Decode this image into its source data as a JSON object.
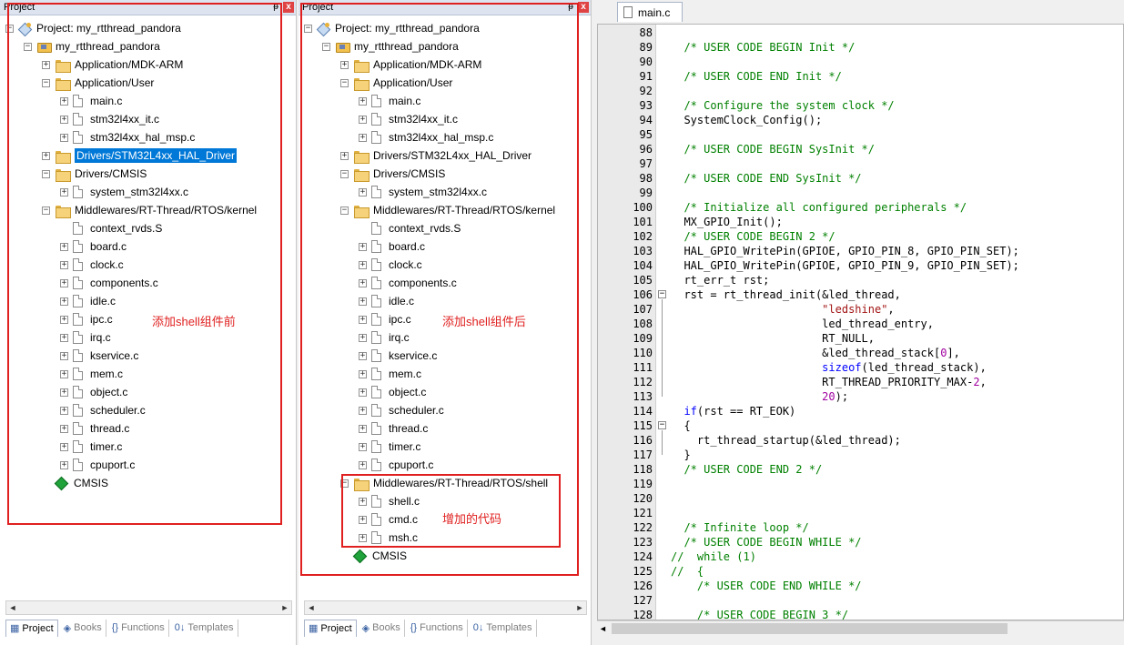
{
  "panel1": {
    "title": "Project",
    "pin": "ᵽ",
    "close": "x",
    "annotation": "添加shell组件前",
    "tree": [
      {
        "label": "Project: my_rtthread_pandora",
        "kind": "project",
        "expander": "−",
        "indent": 0
      },
      {
        "label": "my_rtthread_pandora",
        "kind": "target",
        "expander": "−",
        "indent": 1
      },
      {
        "label": "Application/MDK-ARM",
        "kind": "folder",
        "expander": "+",
        "indent": 2
      },
      {
        "label": "Application/User",
        "kind": "folder",
        "expander": "−",
        "indent": 2
      },
      {
        "label": "main.c",
        "kind": "file",
        "expander": "+",
        "indent": 3
      },
      {
        "label": "stm32l4xx_it.c",
        "kind": "file",
        "expander": "+",
        "indent": 3
      },
      {
        "label": "stm32l4xx_hal_msp.c",
        "kind": "file",
        "expander": "+",
        "indent": 3
      },
      {
        "label": "Drivers/STM32L4xx_HAL_Driver",
        "kind": "folder",
        "expander": "+",
        "indent": 2,
        "selected": true
      },
      {
        "label": "Drivers/CMSIS",
        "kind": "folder",
        "expander": "−",
        "indent": 2
      },
      {
        "label": "system_stm32l4xx.c",
        "kind": "file",
        "expander": "+",
        "indent": 3
      },
      {
        "label": "Middlewares/RT-Thread/RTOS/kernel",
        "kind": "folder",
        "expander": "−",
        "indent": 2
      },
      {
        "label": "context_rvds.S",
        "kind": "file",
        "expander": "",
        "indent": 3
      },
      {
        "label": "board.c",
        "kind": "file",
        "expander": "+",
        "indent": 3
      },
      {
        "label": "clock.c",
        "kind": "file",
        "expander": "+",
        "indent": 3
      },
      {
        "label": "components.c",
        "kind": "file",
        "expander": "+",
        "indent": 3
      },
      {
        "label": "idle.c",
        "kind": "file",
        "expander": "+",
        "indent": 3
      },
      {
        "label": "ipc.c",
        "kind": "file",
        "expander": "+",
        "indent": 3
      },
      {
        "label": "irq.c",
        "kind": "file",
        "expander": "+",
        "indent": 3
      },
      {
        "label": "kservice.c",
        "kind": "file",
        "expander": "+",
        "indent": 3
      },
      {
        "label": "mem.c",
        "kind": "file",
        "expander": "+",
        "indent": 3
      },
      {
        "label": "object.c",
        "kind": "file",
        "expander": "+",
        "indent": 3
      },
      {
        "label": "scheduler.c",
        "kind": "file",
        "expander": "+",
        "indent": 3
      },
      {
        "label": "thread.c",
        "kind": "file",
        "expander": "+",
        "indent": 3
      },
      {
        "label": "timer.c",
        "kind": "file",
        "expander": "+",
        "indent": 3
      },
      {
        "label": "cpuport.c",
        "kind": "file",
        "expander": "+",
        "indent": 3
      },
      {
        "label": "CMSIS",
        "kind": "cmsis",
        "expander": "",
        "indent": 2
      }
    ]
  },
  "panel2": {
    "title": "Project",
    "pin": "ᵽ",
    "close": "x",
    "annotation": "添加shell组件后",
    "annotation2": "增加的代码",
    "tree": [
      {
        "label": "Project: my_rtthread_pandora",
        "kind": "project",
        "expander": "−",
        "indent": 0
      },
      {
        "label": "my_rtthread_pandora",
        "kind": "target",
        "expander": "−",
        "indent": 1
      },
      {
        "label": "Application/MDK-ARM",
        "kind": "folder",
        "expander": "+",
        "indent": 2
      },
      {
        "label": "Application/User",
        "kind": "folder",
        "expander": "−",
        "indent": 2
      },
      {
        "label": "main.c",
        "kind": "file",
        "expander": "+",
        "indent": 3
      },
      {
        "label": "stm32l4xx_it.c",
        "kind": "file",
        "expander": "+",
        "indent": 3
      },
      {
        "label": "stm32l4xx_hal_msp.c",
        "kind": "file",
        "expander": "+",
        "indent": 3
      },
      {
        "label": "Drivers/STM32L4xx_HAL_Driver",
        "kind": "folder",
        "expander": "+",
        "indent": 2
      },
      {
        "label": "Drivers/CMSIS",
        "kind": "folder",
        "expander": "−",
        "indent": 2
      },
      {
        "label": "system_stm32l4xx.c",
        "kind": "file",
        "expander": "+",
        "indent": 3
      },
      {
        "label": "Middlewares/RT-Thread/RTOS/kernel",
        "kind": "folder",
        "expander": "−",
        "indent": 2
      },
      {
        "label": "context_rvds.S",
        "kind": "file",
        "expander": "",
        "indent": 3
      },
      {
        "label": "board.c",
        "kind": "file",
        "expander": "+",
        "indent": 3
      },
      {
        "label": "clock.c",
        "kind": "file",
        "expander": "+",
        "indent": 3
      },
      {
        "label": "components.c",
        "kind": "file",
        "expander": "+",
        "indent": 3
      },
      {
        "label": "idle.c",
        "kind": "file",
        "expander": "+",
        "indent": 3
      },
      {
        "label": "ipc.c",
        "kind": "file",
        "expander": "+",
        "indent": 3
      },
      {
        "label": "irq.c",
        "kind": "file",
        "expander": "+",
        "indent": 3
      },
      {
        "label": "kservice.c",
        "kind": "file",
        "expander": "+",
        "indent": 3
      },
      {
        "label": "mem.c",
        "kind": "file",
        "expander": "+",
        "indent": 3
      },
      {
        "label": "object.c",
        "kind": "file",
        "expander": "+",
        "indent": 3
      },
      {
        "label": "scheduler.c",
        "kind": "file",
        "expander": "+",
        "indent": 3
      },
      {
        "label": "thread.c",
        "kind": "file",
        "expander": "+",
        "indent": 3
      },
      {
        "label": "timer.c",
        "kind": "file",
        "expander": "+",
        "indent": 3
      },
      {
        "label": "cpuport.c",
        "kind": "file",
        "expander": "+",
        "indent": 3
      },
      {
        "label": "Middlewares/RT-Thread/RTOS/shell",
        "kind": "folder",
        "expander": "−",
        "indent": 2
      },
      {
        "label": "shell.c",
        "kind": "file",
        "expander": "+",
        "indent": 3
      },
      {
        "label": "cmd.c",
        "kind": "file",
        "expander": "+",
        "indent": 3
      },
      {
        "label": "msh.c",
        "kind": "file",
        "expander": "+",
        "indent": 3
      },
      {
        "label": "CMSIS",
        "kind": "cmsis",
        "expander": "",
        "indent": 2
      }
    ]
  },
  "bottom_tabs": [
    {
      "label": "Project",
      "icon": "▦",
      "active": true
    },
    {
      "label": "Books",
      "icon": "◈",
      "active": false
    },
    {
      "label": "Functions",
      "icon": "{}",
      "active": false
    },
    {
      "label": "Templates",
      "icon": "0↓",
      "active": false
    }
  ],
  "scroll": {
    "left": "◄",
    "right": "►"
  },
  "editor": {
    "tab": "main.c",
    "lines": [
      {
        "n": "88",
        "fold": "",
        "segs": []
      },
      {
        "n": "89",
        "fold": "",
        "segs": [
          [
            "cm",
            "  /* USER CODE BEGIN Init */"
          ]
        ]
      },
      {
        "n": "90",
        "fold": "",
        "segs": []
      },
      {
        "n": "91",
        "fold": "",
        "segs": [
          [
            "cm",
            "  /* USER CODE END Init */"
          ]
        ]
      },
      {
        "n": "92",
        "fold": "",
        "segs": []
      },
      {
        "n": "93",
        "fold": "",
        "segs": [
          [
            "cm",
            "  /* Configure the system clock */"
          ]
        ]
      },
      {
        "n": "94",
        "fold": "",
        "segs": [
          [
            "",
            "  SystemClock_Config();"
          ]
        ]
      },
      {
        "n": "95",
        "fold": "",
        "segs": []
      },
      {
        "n": "96",
        "fold": "",
        "segs": [
          [
            "cm",
            "  /* USER CODE BEGIN SysInit */"
          ]
        ]
      },
      {
        "n": "97",
        "fold": "",
        "segs": []
      },
      {
        "n": "98",
        "fold": "",
        "segs": [
          [
            "cm",
            "  /* USER CODE END SysInit */"
          ]
        ]
      },
      {
        "n": "99",
        "fold": "",
        "segs": []
      },
      {
        "n": "100",
        "fold": "",
        "segs": [
          [
            "cm",
            "  /* Initialize all configured peripherals */"
          ]
        ]
      },
      {
        "n": "101",
        "fold": "",
        "segs": [
          [
            "",
            "  MX_GPIO_Init();"
          ]
        ]
      },
      {
        "n": "102",
        "fold": "",
        "segs": [
          [
            "cm",
            "  /* USER CODE BEGIN 2 */"
          ]
        ]
      },
      {
        "n": "103",
        "fold": "",
        "segs": [
          [
            "",
            "  HAL_GPIO_WritePin(GPIOE, GPIO_PIN_8, GPIO_PIN_SET);"
          ]
        ]
      },
      {
        "n": "104",
        "fold": "",
        "segs": [
          [
            "",
            "  HAL_GPIO_WritePin(GPIOE, GPIO_PIN_9, GPIO_PIN_SET);"
          ]
        ]
      },
      {
        "n": "105",
        "fold": "",
        "segs": [
          [
            "",
            "  rt_err_t rst;"
          ]
        ]
      },
      {
        "n": "106",
        "fold": "−",
        "segs": [
          [
            "",
            "  rst = rt_thread_init(&led_thread,"
          ]
        ]
      },
      {
        "n": "107",
        "fold": "",
        "segs": [
          [
            "",
            "                       "
          ],
          [
            "st",
            "\"ledshine\""
          ],
          [
            "",
            ","
          ]
        ]
      },
      {
        "n": "108",
        "fold": "",
        "segs": [
          [
            "",
            "                       led_thread_entry,"
          ]
        ]
      },
      {
        "n": "109",
        "fold": "",
        "segs": [
          [
            "",
            "                       RT_NULL,"
          ]
        ]
      },
      {
        "n": "110",
        "fold": "",
        "segs": [
          [
            "",
            "                       &led_thread_stack["
          ],
          [
            "nm",
            "0"
          ],
          [
            "",
            "],"
          ]
        ]
      },
      {
        "n": "111",
        "fold": "",
        "segs": [
          [
            "",
            "                       "
          ],
          [
            "kw",
            "sizeof"
          ],
          [
            "",
            "(led_thread_stack),"
          ]
        ]
      },
      {
        "n": "112",
        "fold": "",
        "segs": [
          [
            "",
            "                       RT_THREAD_PRIORITY_MAX-"
          ],
          [
            "nm",
            "2"
          ],
          [
            "",
            ","
          ]
        ]
      },
      {
        "n": "113",
        "fold": "",
        "segs": [
          [
            "",
            "                       "
          ],
          [
            "nm",
            "20"
          ],
          [
            "",
            ");"
          ]
        ]
      },
      {
        "n": "114",
        "fold": "",
        "segs": [
          [
            "",
            "  "
          ],
          [
            "kw",
            "if"
          ],
          [
            "",
            "(rst == RT_EOK)"
          ]
        ]
      },
      {
        "n": "115",
        "fold": "−",
        "segs": [
          [
            "",
            "  {"
          ]
        ]
      },
      {
        "n": "116",
        "fold": "",
        "segs": [
          [
            "",
            "    rt_thread_startup(&led_thread);"
          ]
        ]
      },
      {
        "n": "117",
        "fold": "",
        "segs": [
          [
            "",
            "  }"
          ]
        ]
      },
      {
        "n": "118",
        "fold": "",
        "segs": [
          [
            "cm",
            "  /* USER CODE END 2 */"
          ]
        ]
      },
      {
        "n": "119",
        "fold": "",
        "segs": []
      },
      {
        "n": "120",
        "fold": "",
        "segs": []
      },
      {
        "n": "121",
        "fold": "",
        "segs": []
      },
      {
        "n": "122",
        "fold": "",
        "segs": [
          [
            "cm",
            "  /* Infinite loop */"
          ]
        ]
      },
      {
        "n": "123",
        "fold": "",
        "segs": [
          [
            "cm",
            "  /* USER CODE BEGIN WHILE */"
          ]
        ]
      },
      {
        "n": "124",
        "fold": "",
        "segs": [
          [
            "cm",
            "//  while (1)"
          ]
        ]
      },
      {
        "n": "125",
        "fold": "",
        "segs": [
          [
            "cm",
            "//  {"
          ]
        ]
      },
      {
        "n": "126",
        "fold": "",
        "segs": [
          [
            "cm",
            "    /* USER CODE END WHILE */"
          ]
        ]
      },
      {
        "n": "127",
        "fold": "",
        "segs": []
      },
      {
        "n": "128",
        "fold": "",
        "segs": [
          [
            "cm",
            "    /* USER CODE BEGIN 3 */"
          ]
        ]
      }
    ]
  }
}
